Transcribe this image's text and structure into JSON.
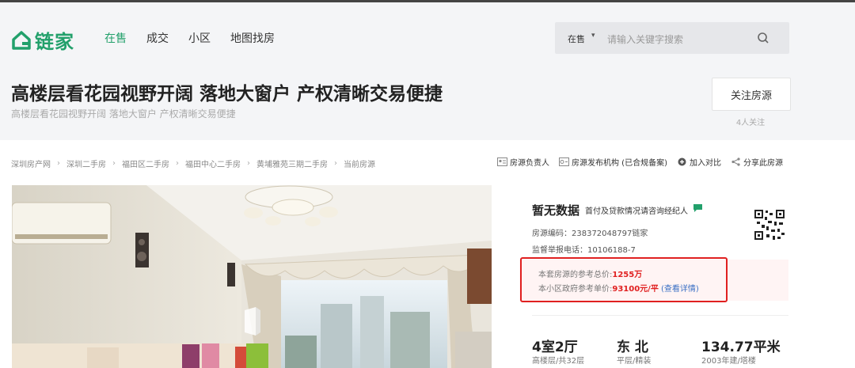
{
  "brand": {
    "name": "链家",
    "color": "#22a06b",
    "logo_icon": "house-icon"
  },
  "nav": {
    "items": [
      {
        "label": "在售",
        "active": true
      },
      {
        "label": "成交",
        "active": false
      },
      {
        "label": "小区",
        "active": false
      },
      {
        "label": "地图找房",
        "active": false
      }
    ]
  },
  "search": {
    "scope": "在售",
    "placeholder": "请输入关键字搜索",
    "icon": "search-icon"
  },
  "listing": {
    "title": "高楼层看花园视野开阔 落地大窗户 产权清晰交易便捷",
    "subtitle": "高楼层看花园视野开阔 落地大窗户 产权清晰交易便捷",
    "follow_label": "关注房源",
    "follow_count": "4人关注"
  },
  "breadcrumb": [
    "深圳房产网",
    "深圳二手房",
    "福田区二手房",
    "福田中心二手房",
    "黄埔雅苑三期二手房",
    "当前房源"
  ],
  "tools": [
    {
      "label": "房源负责人",
      "icon": "agent-icon"
    },
    {
      "label": "房源发布机构 (已合规备案)",
      "icon": "agency-icon"
    },
    {
      "label": "加入对比",
      "icon": "compare-icon"
    },
    {
      "label": "分享此房源",
      "icon": "share-icon"
    }
  ],
  "info": {
    "price_label": "暂无数据",
    "price_note": "首付及贷款情况请咨询经纪人",
    "code": "房源编码：23837204879​7链家",
    "hotline": "监督举报电话：10106188-7",
    "ref_total_label": "本套房源的参考总价:",
    "ref_total_value": "1255万",
    "ref_unit_label": "本小区政府参考单价:",
    "ref_unit_value": "93100元/平",
    "ref_detail_link": "(查看详情)",
    "highlight_color": "#e02020"
  },
  "stats": [
    {
      "main": "4室2厅",
      "sub": "高楼层/共32层"
    },
    {
      "main": "东 北",
      "sub": "平层/精装"
    },
    {
      "main": "134.77平米",
      "sub": "2003年建/塔楼"
    }
  ]
}
